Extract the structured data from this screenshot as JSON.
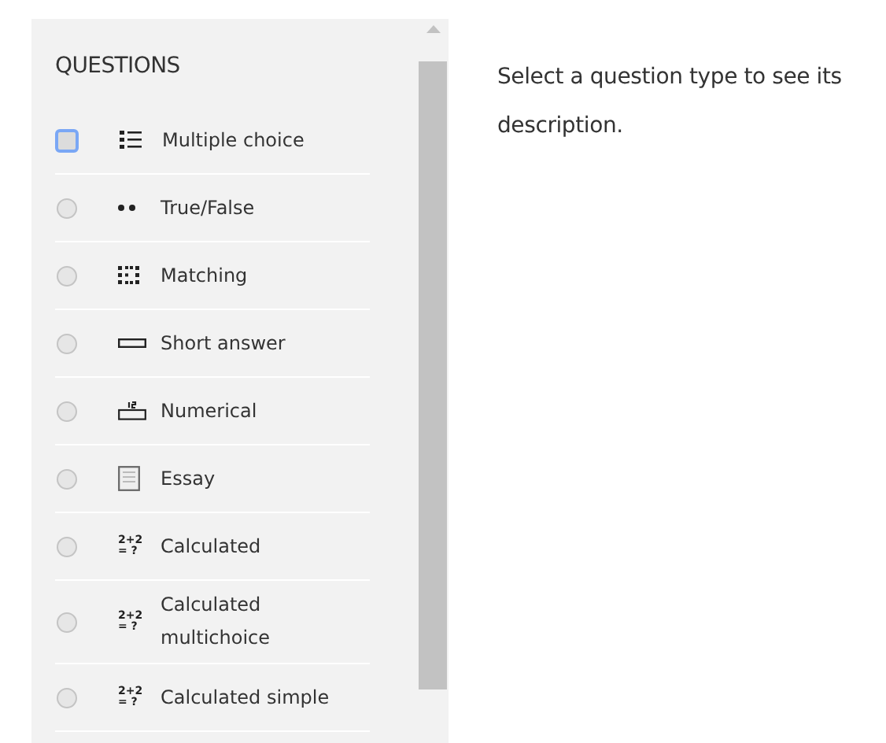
{
  "panel": {
    "title": "QUESTIONS"
  },
  "questions": [
    {
      "label": "Multiple choice",
      "kind": "multichoice",
      "selected": true
    },
    {
      "label": "True/False",
      "kind": "truefalse",
      "selected": false
    },
    {
      "label": "Matching",
      "kind": "matching",
      "selected": false
    },
    {
      "label": "Short answer",
      "kind": "shortanswer",
      "selected": false
    },
    {
      "label": "Numerical",
      "kind": "numerical",
      "selected": false
    },
    {
      "label": "Essay",
      "kind": "essay",
      "selected": false
    },
    {
      "label": "Calculated",
      "kind": "calculated",
      "icon_text": [
        "2+2",
        "= ?"
      ],
      "selected": false
    },
    {
      "label": "Calculated multichoice",
      "kind": "calculated",
      "icon_text": [
        "2+2",
        "= ?"
      ],
      "selected": false
    },
    {
      "label": "Calculated simple",
      "kind": "calculated",
      "icon_text": [
        "2+2",
        "= ?"
      ],
      "selected": false
    }
  ],
  "description": "Select a question type to see its description."
}
